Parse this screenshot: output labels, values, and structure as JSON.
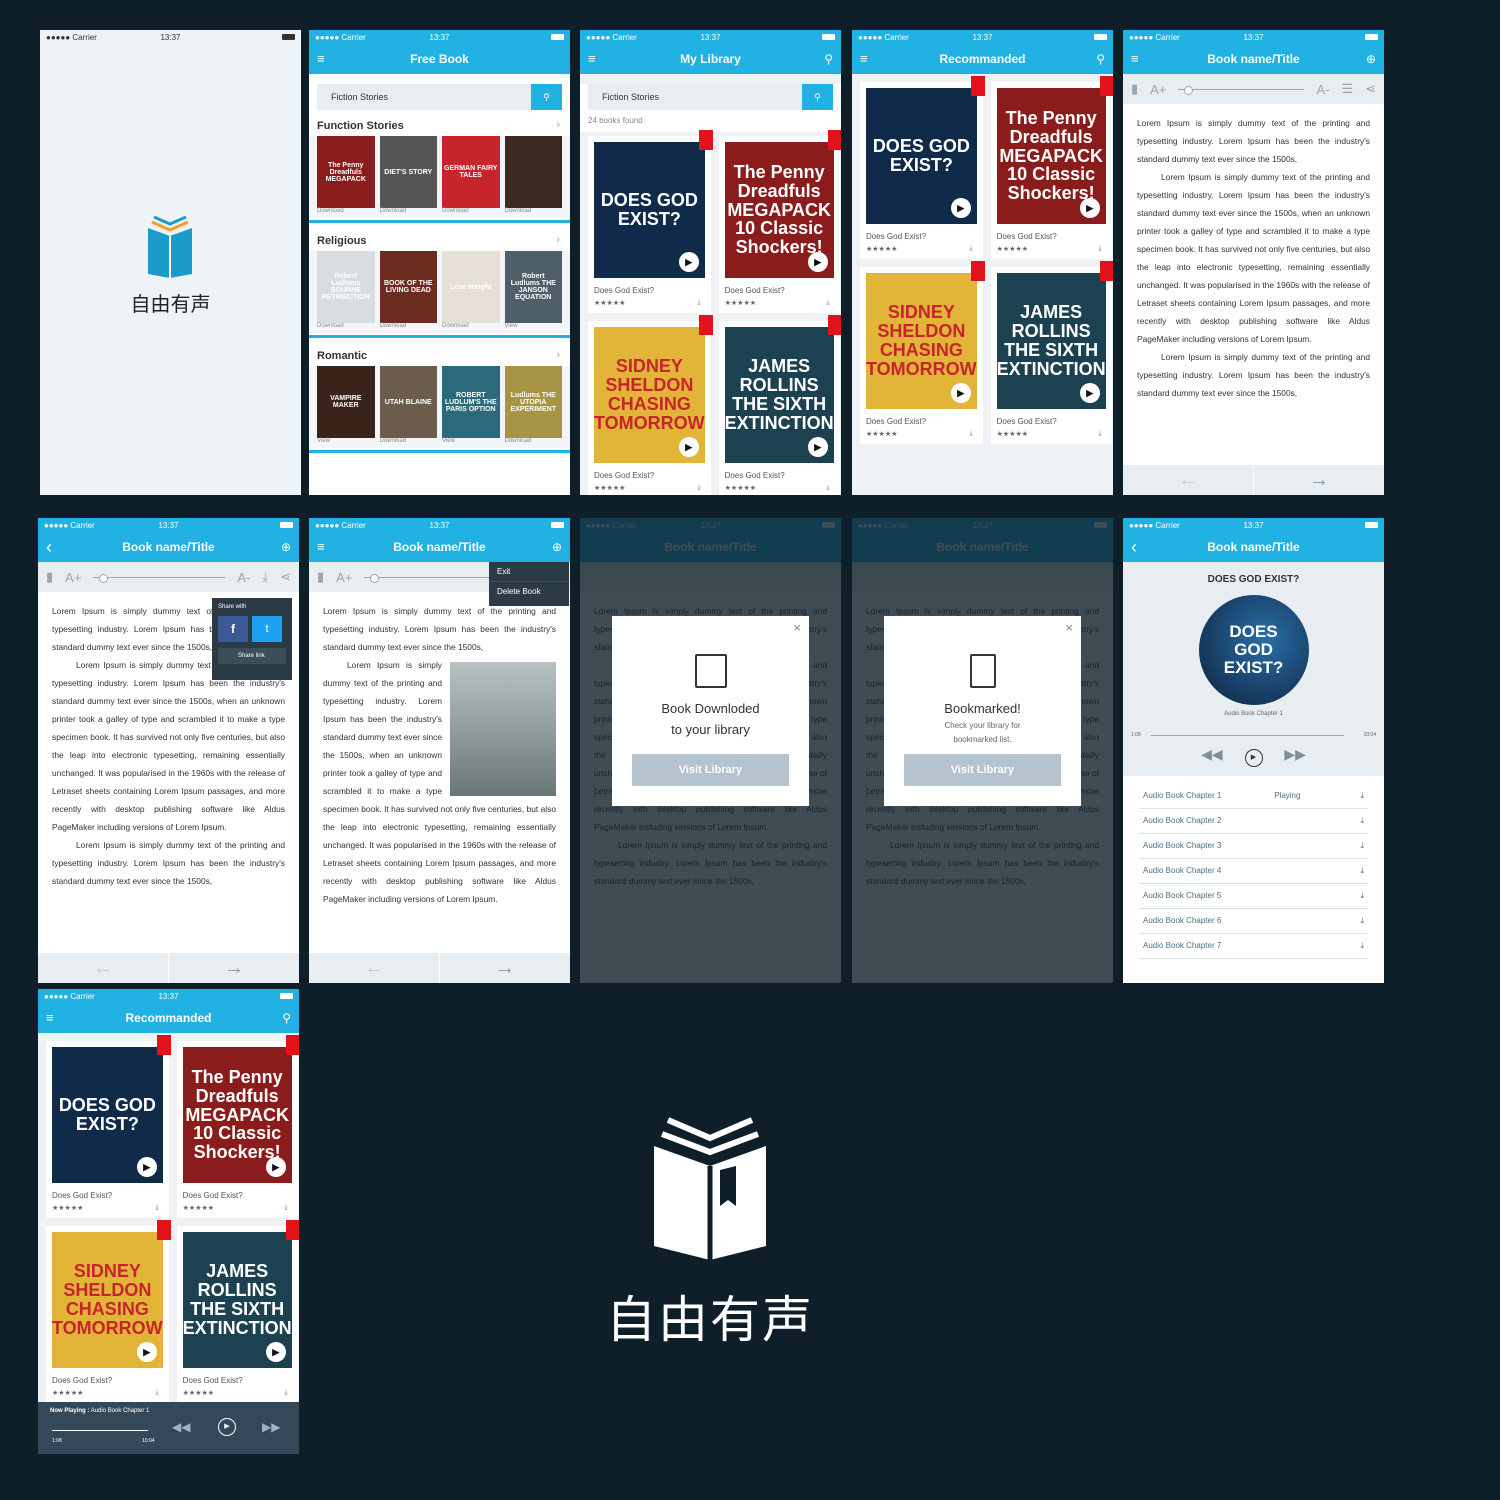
{
  "status": {
    "carrier": "●●●●● Carrier",
    "time": "13:37"
  },
  "brand": {
    "name": "自由有声"
  },
  "icons": {
    "menu": "≡",
    "search": "⚲",
    "back": "‹",
    "plus": "⊕",
    "play": "▶",
    "download": "⤓",
    "bookmark": "🔖",
    "share": "<",
    "settings": "⚙",
    "close": "×",
    "prev_arrow": "←",
    "next_arrow": "→",
    "chevron": "›"
  },
  "free_book": {
    "title": "Free Book",
    "search_value": "Fiction Stories",
    "sections": [
      {
        "title": "Function Stories",
        "books": [
          {
            "cover": "The Penny Dreadfuls MEGAPACK",
            "label": "Download",
            "color": "#8a1c1c"
          },
          {
            "cover": "DIET'S STORY",
            "label": "Download",
            "color": "#555"
          },
          {
            "cover": "GERMAN FAIRY TALES",
            "label": "Download",
            "color": "#c8242c"
          },
          {
            "cover": "",
            "label": "Download",
            "color": "#3a2a20"
          }
        ]
      },
      {
        "title": "Religious",
        "books": [
          {
            "cover": "Robert Ludlums BOURNE RETRIBUTION",
            "label": "Download",
            "color": "#d7dde0"
          },
          {
            "cover": "BOOK OF THE LIVING DEAD",
            "label": "Download",
            "color": "#6b2d1f"
          },
          {
            "cover": "Lose Weight",
            "label": "Download",
            "color": "#e7e0d9"
          },
          {
            "cover": "Robert Ludlums THE JANSON EQUATION",
            "label": "View",
            "color": "#4f5f6a"
          }
        ]
      },
      {
        "title": "Romantic",
        "books": [
          {
            "cover": "VAMPIRE MAKER",
            "label": "View",
            "color": "#3a2419"
          },
          {
            "cover": "UTAH BLAINE",
            "label": "Download",
            "color": "#6b5c4b"
          },
          {
            "cover": "ROBERT LUDLUM'S THE PARIS OPTION",
            "label": "View",
            "color": "#2b6a7a"
          },
          {
            "cover": "Ludlums THE UTOPIA EXPERIMENT",
            "label": "Download",
            "color": "#a89445"
          }
        ]
      }
    ]
  },
  "library": {
    "title": "My Library",
    "search_value": "Fiction Stories",
    "found": "24 books found"
  },
  "recommended": {
    "title": "Recommanded",
    "books": [
      {
        "cover": "DOES GOD EXIST?",
        "title": "Does God Exist?",
        "color": "#102a4a"
      },
      {
        "cover": "The Penny Dreadfuls MEGAPACK 10 Classic Shockers!",
        "title": "Does God Exist?",
        "color": "#8a1c1c"
      },
      {
        "cover": "SIDNEY SHELDON CHASING TOMORROW",
        "title": "Does God Exist?",
        "color": "#e2b538"
      },
      {
        "cover": "JAMES ROLLINS THE SIXTH EXTINCTION",
        "title": "Does God Exist?",
        "color": "#1c4150"
      }
    ],
    "stars": "★★★★★"
  },
  "reader": {
    "title": "Book name/Title",
    "font_up": "A+",
    "font_down": "A-",
    "para1": "Lorem Ipsum is simply dummy text of the printing and typesetting industry. Lorem Ipsum has been the industry's standard dummy text ever since the 1500s,",
    "para2": "Lorem Ipsum is simply dummy text of the printing and typesetting industry. Lorem Ipsum has been the industry's standard dummy text ever since the 1500s, when an unknown printer took a galley of type and scrambled it to make a type specimen book. It has survived not only five centuries, but also the leap into electronic typesetting, remaining essentially unchanged. It was popularised in the 1960s with the release of Letraset sheets containing Lorem Ipsum passages, and more recently with desktop publishing software like Aldus PageMaker including versions of Lorem Ipsum.",
    "para3": "Lorem Ipsum is simply dummy text of the printing and typesetting industry. Lorem Ipsum has been the industry's standard dummy text ever since the 1500s,",
    "para4": "Lorem Ipsum is simply dummy text of the printing and"
  },
  "share": {
    "title": "Share with",
    "link": "Share link"
  },
  "menu": {
    "exit": "Exit",
    "delete": "Delete Book"
  },
  "modal_download": {
    "title1": "Book Downloded",
    "title2": "to your library",
    "button": "Visit Library"
  },
  "modal_bookmark": {
    "title": "Bookmarked!",
    "sub1": "Check your library for",
    "sub2": "bookmarked list.",
    "button": "Visit Library"
  },
  "audio": {
    "book_title": "DOES GOD EXIST?",
    "cover": "DOES GOD EXIST?",
    "chapter_now": "Audio Book Chapter 1",
    "time_start": "1:08",
    "time_end": "10:04",
    "playing": "Playing",
    "chapters": [
      "Audio Book Chapter 1",
      "Audio Book Chapter 2",
      "Audio Book Chapter 3",
      "Audio Book Chapter 4",
      "Audio Book Chapter 5",
      "Audio Book Chapter 6",
      "Audio Book Chapter 7"
    ]
  },
  "now_playing": {
    "label": "Now Playing :",
    "track": "Audio Book Chapter 1",
    "time_start": "1:08",
    "time_end": "10:04"
  },
  "colors": {
    "accent": "#22b1e3",
    "dark_bg": "#0f1f29",
    "ribbon": "#e1121a"
  }
}
